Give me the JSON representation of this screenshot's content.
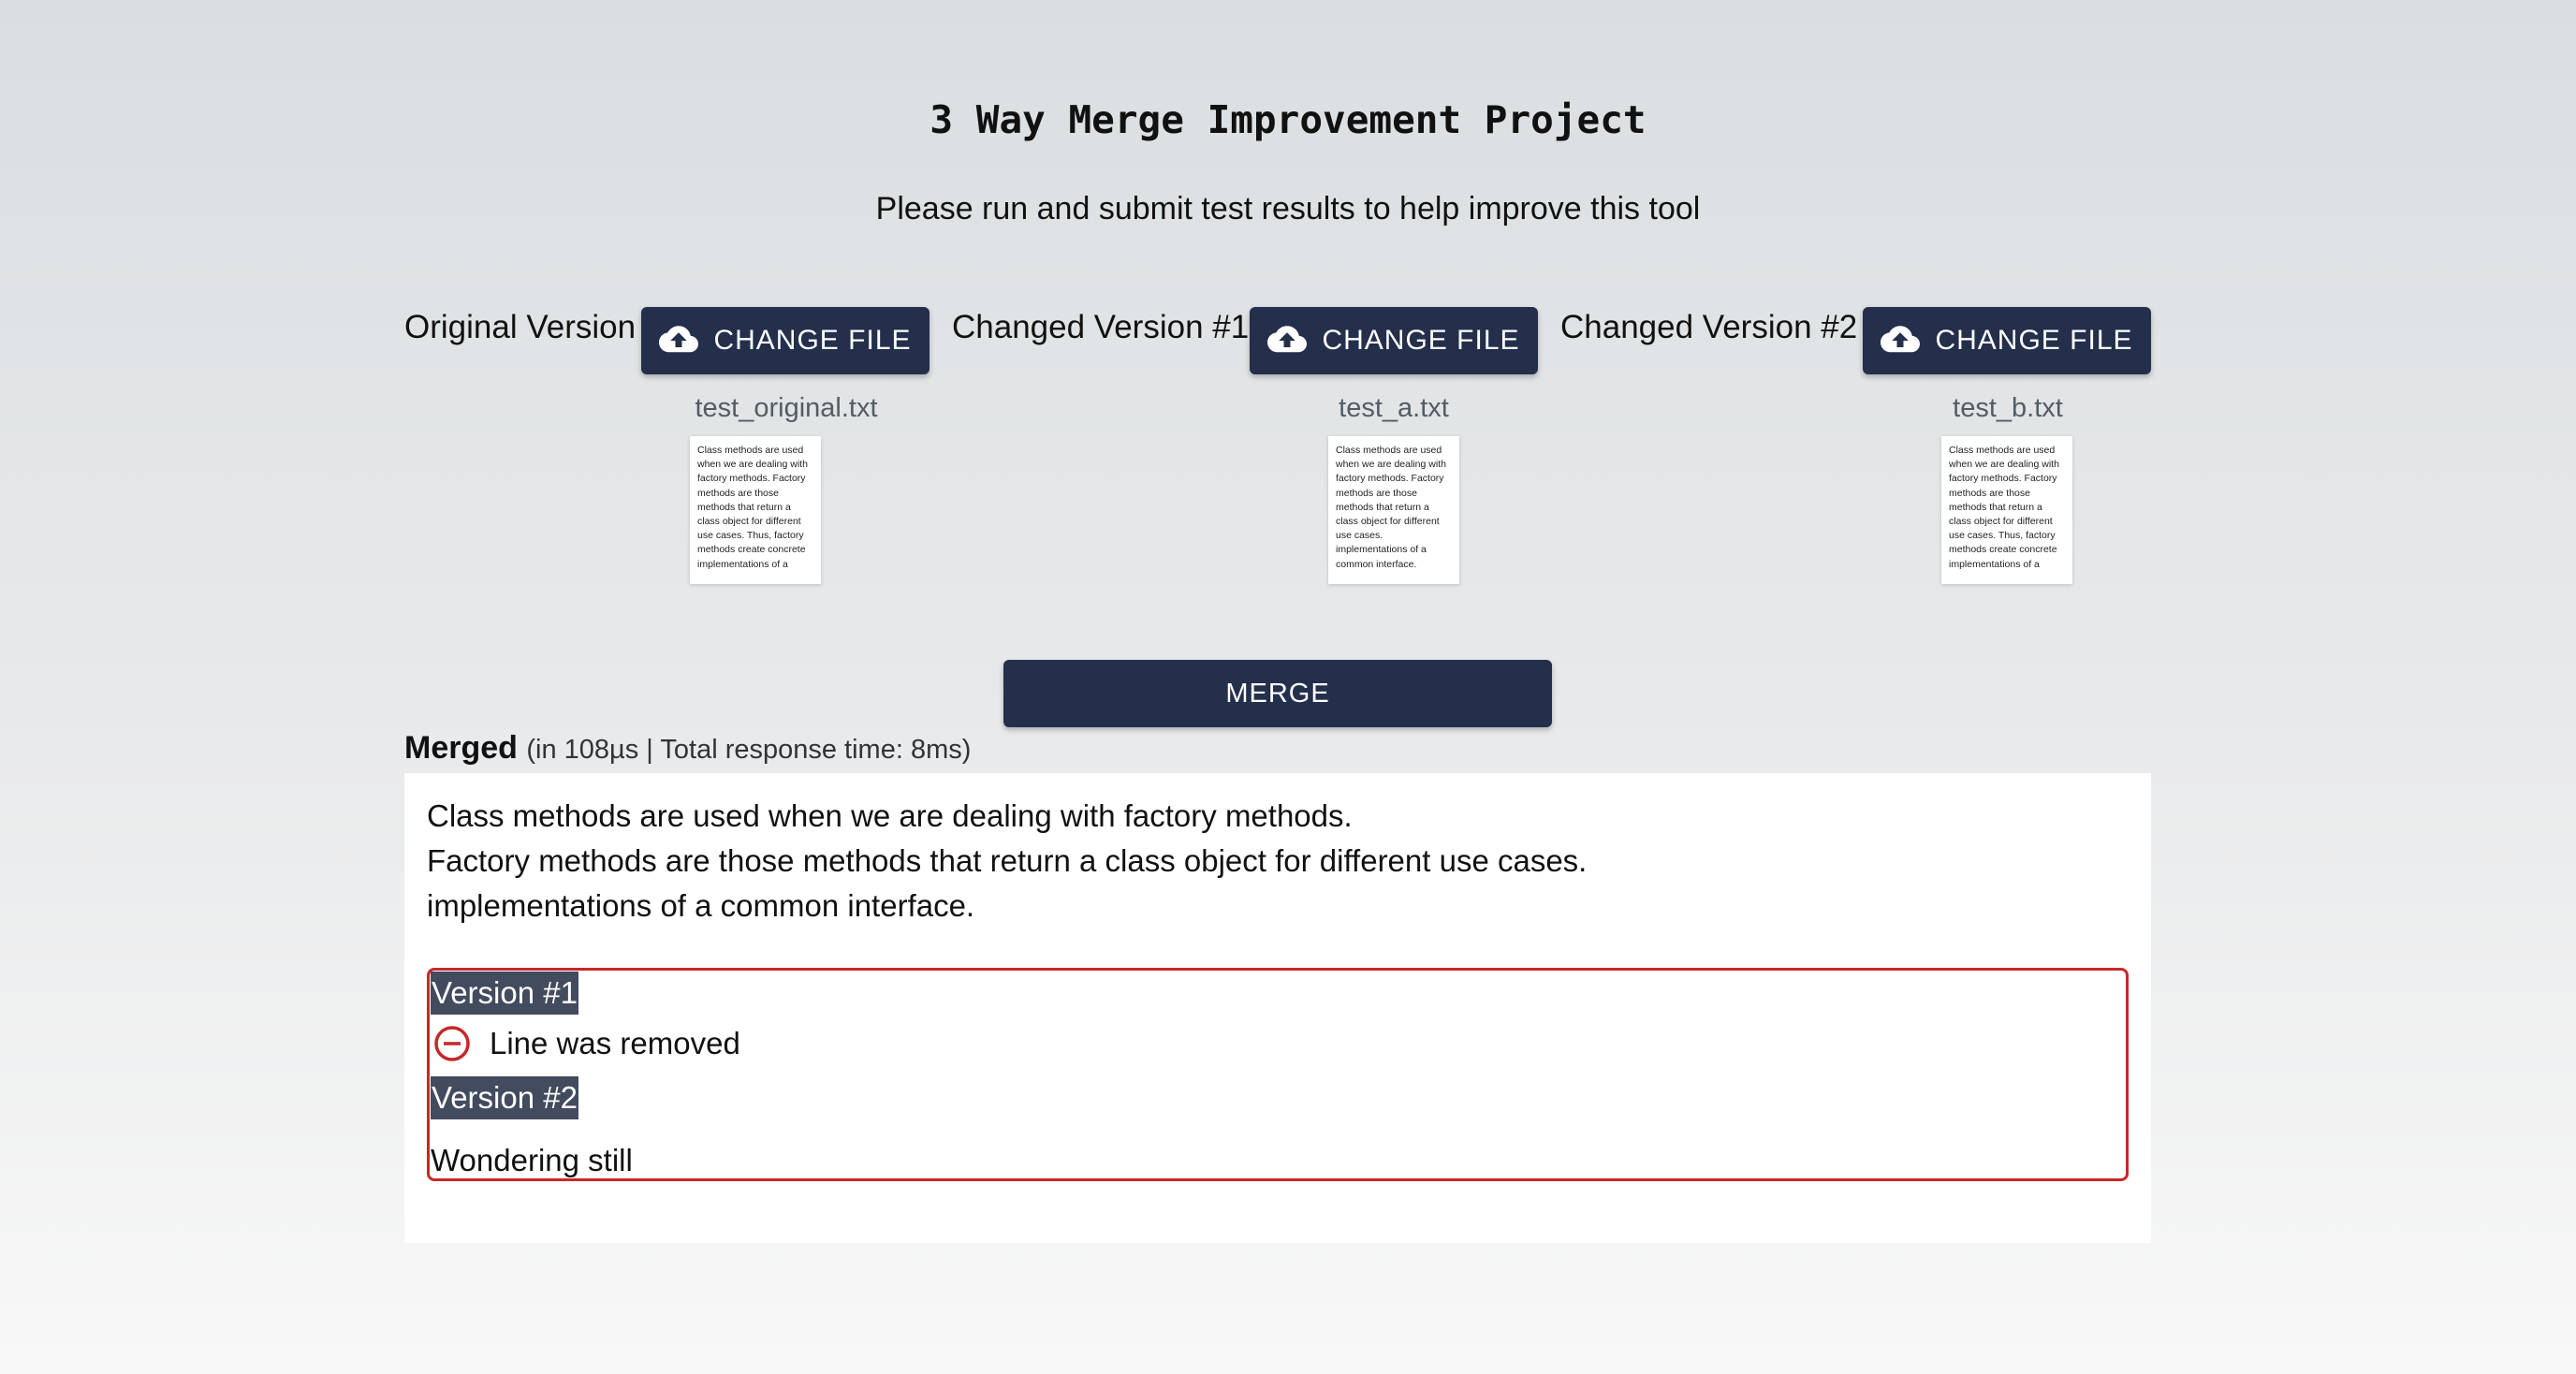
{
  "header": {
    "title": "3 Way Merge Improvement Project",
    "subtitle": "Please run and submit test results to help improve this tool"
  },
  "files": [
    {
      "label": "Original Version",
      "button_label": "CHANGE FILE",
      "button_icon": "cloud-upload-icon",
      "filename": "test_original.txt",
      "preview": "Class methods are used when we are dealing with factory methods. Factory methods are those methods that return a class object for different use cases. Thus, factory methods create concrete implementations of a"
    },
    {
      "label": "Changed Version #1",
      "button_label": "CHANGE FILE",
      "button_icon": "cloud-upload-icon",
      "filename": "test_a.txt",
      "preview": "Class methods are used when we are dealing with factory methods. Factory methods are those methods that return a class object for different use cases. implementations of a common interface."
    },
    {
      "label": "Changed Version #2",
      "button_label": "CHANGE FILE",
      "button_icon": "cloud-upload-icon",
      "filename": "test_b.txt",
      "preview": "Class methods are used when we are dealing with factory methods. Factory methods are those methods that return a class object for different use cases. Thus, factory methods create concrete implementations of a"
    }
  ],
  "merge_button_label": "MERGE",
  "merged": {
    "heading": "Merged",
    "timing": "(in 108µs | Total response time: 8ms)",
    "lines": [
      "Class methods are used when we are dealing with factory methods.",
      "Factory methods are those methods that return a class object for different use cases.",
      "implementations of a common interface."
    ],
    "conflict": {
      "version1_label": "Version #1",
      "version1_icon": "minus-circle-icon",
      "version1_text": "Line was removed",
      "version2_label": "Version #2",
      "version2_text": "Wondering still"
    }
  },
  "colors": {
    "button_bg": "#232f4b",
    "conflict_border": "#c62828",
    "version_tag_bg": "#434b5e"
  }
}
